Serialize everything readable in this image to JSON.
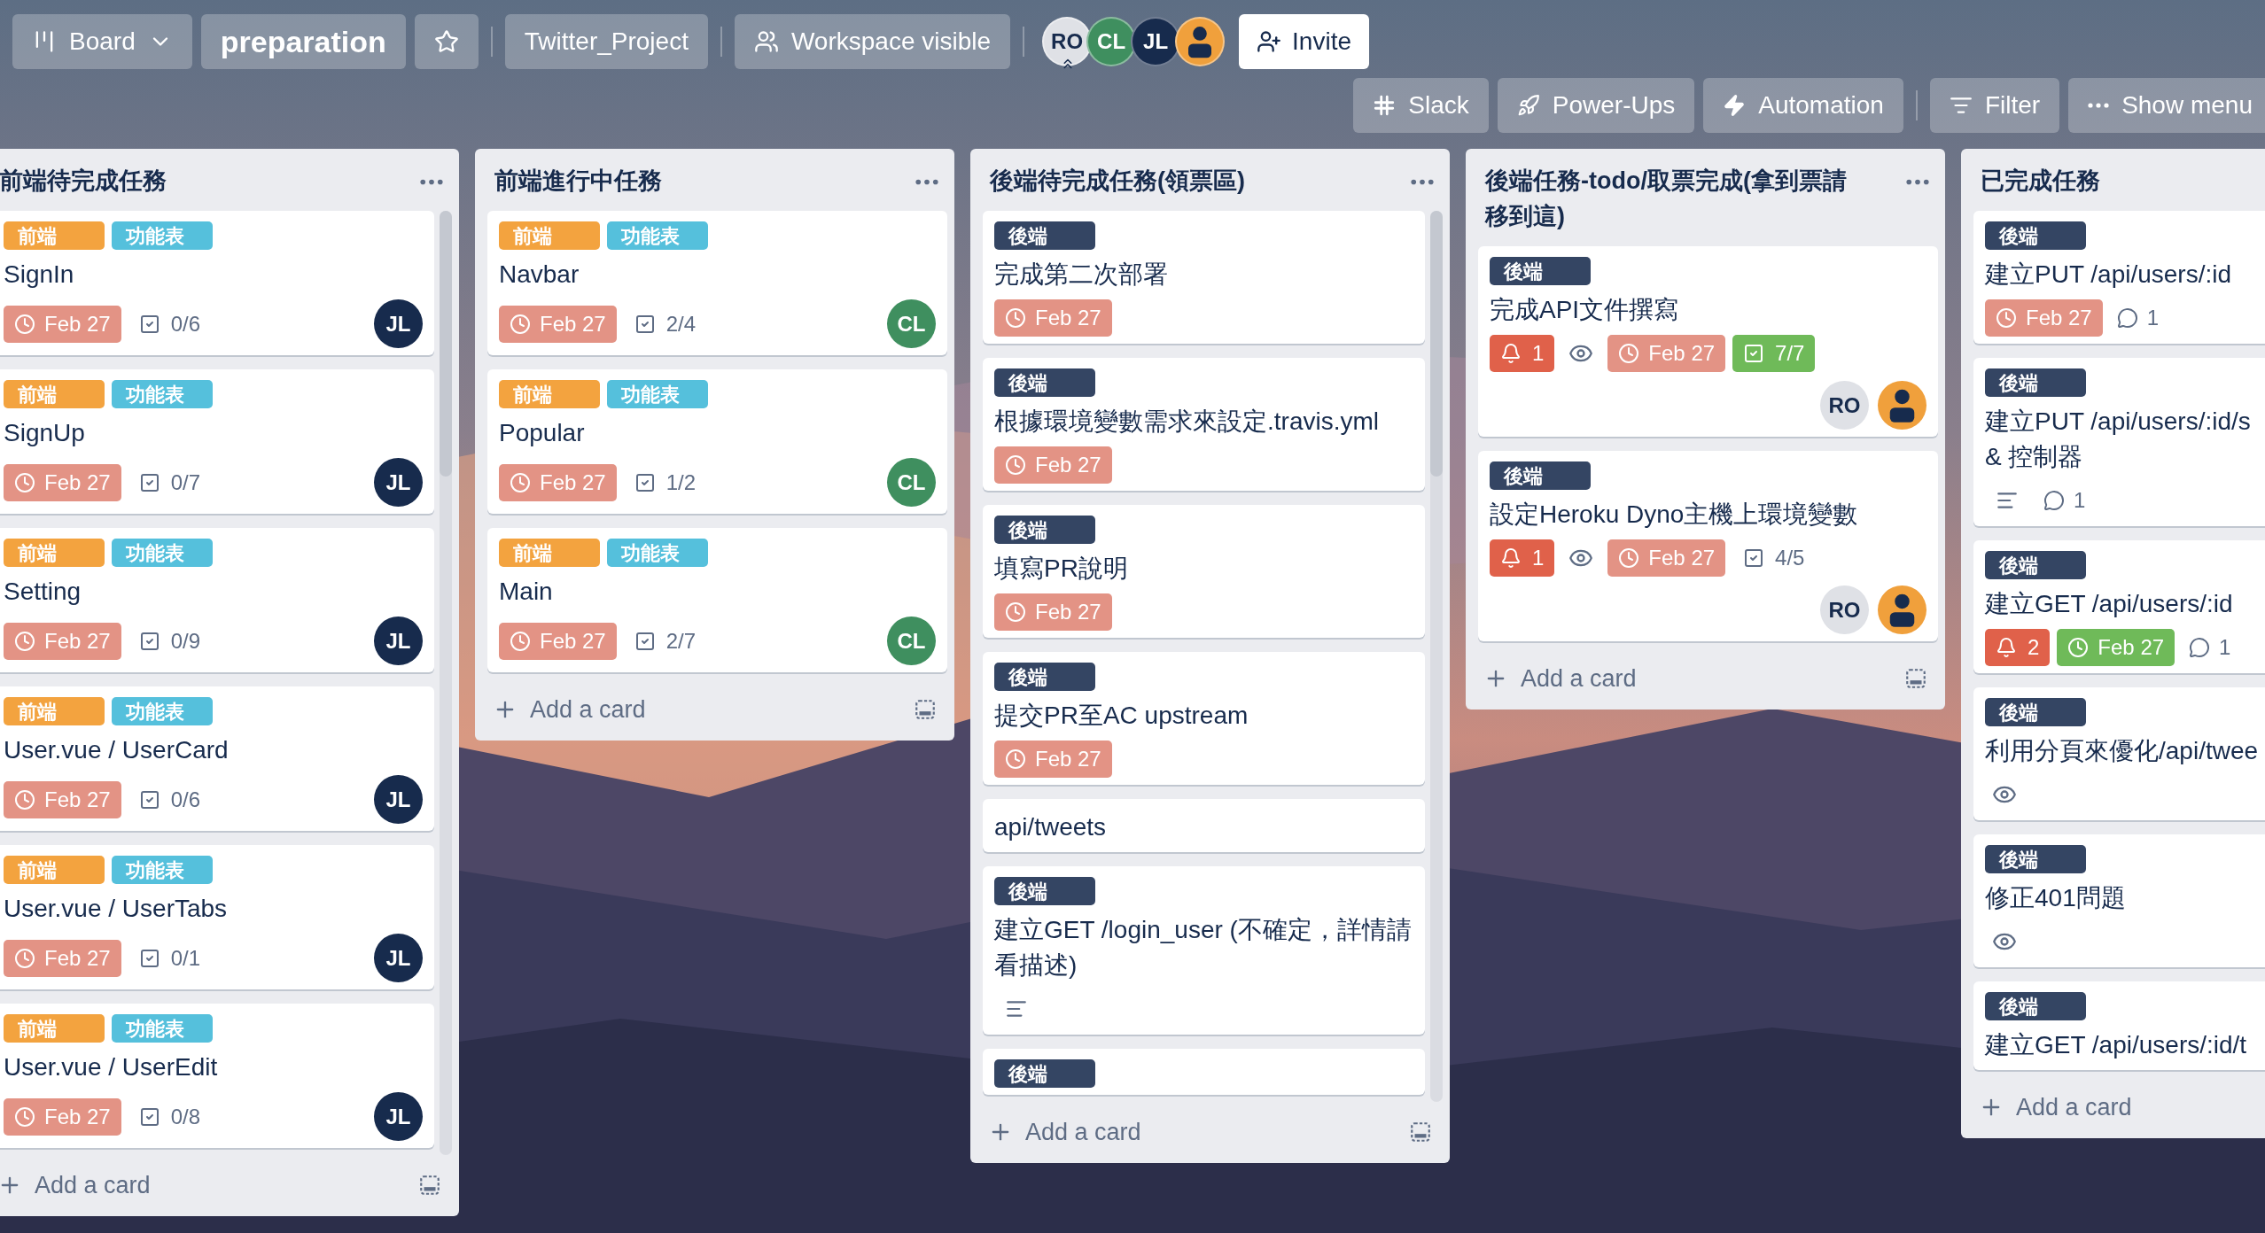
{
  "header": {
    "board_switcher": "Board",
    "board_title": "preparation",
    "starred": false,
    "workspace": "Twitter_Project",
    "visibility": "Workspace visible",
    "members": [
      {
        "kind": "initials",
        "text": "RO",
        "color": "#dfe1e6",
        "admin": true
      },
      {
        "kind": "initials",
        "text": "CL",
        "color": "#3f8f5f",
        "admin": false
      },
      {
        "kind": "initials",
        "text": "JL",
        "color": "#172b4d",
        "admin": false
      },
      {
        "kind": "default",
        "color": "#f0a03c",
        "admin": false
      }
    ],
    "invite": "Invite",
    "toolbar": [
      {
        "kind": "slack",
        "label": "Slack"
      },
      {
        "kind": "power-ups",
        "label": "Power-Ups"
      },
      {
        "kind": "automation",
        "label": "Automation"
      },
      {
        "kind": "filter",
        "label": "Filter"
      },
      {
        "kind": "menu",
        "label": "Show menu"
      }
    ]
  },
  "lists": [
    {
      "title": "前端待完成任務",
      "menu": true,
      "template": true,
      "scrollbar": true,
      "add_card": "Add a card",
      "cards": [
        {
          "labels": [
            {
              "text": "前端",
              "color": "#f3a33f"
            },
            {
              "text": "功能表",
              "color": "#55c0dc"
            }
          ],
          "title": "SignIn",
          "badges": [
            {
              "kind": "due",
              "text": "Feb 27",
              "complete": false
            },
            {
              "kind": "checklist",
              "text": "0/6",
              "complete": false
            }
          ],
          "members": [
            {
              "kind": "initials",
              "text": "JL",
              "color": "#172b4d"
            }
          ]
        },
        {
          "labels": [
            {
              "text": "前端",
              "color": "#f3a33f"
            },
            {
              "text": "功能表",
              "color": "#55c0dc"
            }
          ],
          "title": "SignUp",
          "badges": [
            {
              "kind": "due",
              "text": "Feb 27",
              "complete": false
            },
            {
              "kind": "checklist",
              "text": "0/7",
              "complete": false
            }
          ],
          "members": [
            {
              "kind": "initials",
              "text": "JL",
              "color": "#172b4d"
            }
          ]
        },
        {
          "labels": [
            {
              "text": "前端",
              "color": "#f3a33f"
            },
            {
              "text": "功能表",
              "color": "#55c0dc"
            }
          ],
          "title": "Setting",
          "badges": [
            {
              "kind": "due",
              "text": "Feb 27",
              "complete": false
            },
            {
              "kind": "checklist",
              "text": "0/9",
              "complete": false
            }
          ],
          "members": [
            {
              "kind": "initials",
              "text": "JL",
              "color": "#172b4d"
            }
          ]
        },
        {
          "labels": [
            {
              "text": "前端",
              "color": "#f3a33f"
            },
            {
              "text": "功能表",
              "color": "#55c0dc"
            }
          ],
          "title": "User.vue / UserCard",
          "badges": [
            {
              "kind": "due",
              "text": "Feb 27",
              "complete": false
            },
            {
              "kind": "checklist",
              "text": "0/6",
              "complete": false
            }
          ],
          "members": [
            {
              "kind": "initials",
              "text": "JL",
              "color": "#172b4d"
            }
          ]
        },
        {
          "labels": [
            {
              "text": "前端",
              "color": "#f3a33f"
            },
            {
              "text": "功能表",
              "color": "#55c0dc"
            }
          ],
          "title": "User.vue / UserTabs",
          "badges": [
            {
              "kind": "due",
              "text": "Feb 27",
              "complete": false
            },
            {
              "kind": "checklist",
              "text": "0/1",
              "complete": false
            }
          ],
          "members": [
            {
              "kind": "initials",
              "text": "JL",
              "color": "#172b4d"
            }
          ]
        },
        {
          "labels": [
            {
              "text": "前端",
              "color": "#f3a33f"
            },
            {
              "text": "功能表",
              "color": "#55c0dc"
            }
          ],
          "title": "User.vue / UserEdit",
          "badges": [
            {
              "kind": "due",
              "text": "Feb 27",
              "complete": false
            },
            {
              "kind": "checklist",
              "text": "0/8",
              "complete": false
            }
          ],
          "members": [
            {
              "kind": "initials",
              "text": "JL",
              "color": "#172b4d"
            }
          ]
        }
      ]
    },
    {
      "title": "前端進行中任務",
      "menu": true,
      "template": true,
      "scrollbar": false,
      "add_card": "Add a card",
      "cards": [
        {
          "labels": [
            {
              "text": "前端",
              "color": "#f3a33f"
            },
            {
              "text": "功能表",
              "color": "#55c0dc"
            }
          ],
          "title": "Navbar",
          "badges": [
            {
              "kind": "due",
              "text": "Feb 27",
              "complete": false
            },
            {
              "kind": "checklist",
              "text": "2/4",
              "complete": false
            }
          ],
          "members": [
            {
              "kind": "initials",
              "text": "CL",
              "color": "#3f8f5f"
            }
          ]
        },
        {
          "labels": [
            {
              "text": "前端",
              "color": "#f3a33f"
            },
            {
              "text": "功能表",
              "color": "#55c0dc"
            }
          ],
          "title": "Popular",
          "badges": [
            {
              "kind": "due",
              "text": "Feb 27",
              "complete": false
            },
            {
              "kind": "checklist",
              "text": "1/2",
              "complete": false
            }
          ],
          "members": [
            {
              "kind": "initials",
              "text": "CL",
              "color": "#3f8f5f"
            }
          ]
        },
        {
          "labels": [
            {
              "text": "前端",
              "color": "#f3a33f"
            },
            {
              "text": "功能表",
              "color": "#55c0dc"
            }
          ],
          "title": "Main",
          "badges": [
            {
              "kind": "due",
              "text": "Feb 27",
              "complete": false
            },
            {
              "kind": "checklist",
              "text": "2/7",
              "complete": false
            }
          ],
          "members": [
            {
              "kind": "initials",
              "text": "CL",
              "color": "#3f8f5f"
            }
          ]
        }
      ]
    },
    {
      "title": "後端待完成任務(領票區)",
      "menu": true,
      "template": true,
      "scrollbar": true,
      "add_card": "Add a card",
      "cards": [
        {
          "labels": [
            {
              "text": "後端",
              "color": "#344563"
            }
          ],
          "title": "完成第二次部署",
          "badges": [
            {
              "kind": "due",
              "text": "Feb 27",
              "complete": false
            }
          ]
        },
        {
          "labels": [
            {
              "text": "後端",
              "color": "#344563"
            }
          ],
          "title": "根據環境變數需求來設定.travis.yml",
          "badges": [
            {
              "kind": "due",
              "text": "Feb 27",
              "complete": false
            }
          ]
        },
        {
          "labels": [
            {
              "text": "後端",
              "color": "#344563"
            }
          ],
          "title": "填寫PR說明",
          "badges": [
            {
              "kind": "due",
              "text": "Feb 27",
              "complete": false
            }
          ]
        },
        {
          "labels": [
            {
              "text": "後端",
              "color": "#344563"
            }
          ],
          "title": "提交PR至AC upstream",
          "badges": [
            {
              "kind": "due",
              "text": "Feb 27",
              "complete": false
            }
          ]
        },
        {
          "title": "api/tweets"
        },
        {
          "labels": [
            {
              "text": "後端",
              "color": "#344563"
            }
          ],
          "title": "建立GET /login_user (不確定，詳情請看描述)",
          "badges": [
            {
              "kind": "description"
            }
          ]
        },
        {
          "labels": [
            {
              "text": "後端",
              "color": "#344563"
            }
          ]
        }
      ]
    },
    {
      "title": "後端任務-todo/取票完成(拿到票請移到這)",
      "menu": true,
      "template": true,
      "scrollbar": false,
      "add_card": "Add a card",
      "cards": [
        {
          "labels": [
            {
              "text": "後端",
              "color": "#344563"
            }
          ],
          "title": "完成API文件撰寫",
          "badges": [
            {
              "kind": "notification",
              "text": "1"
            },
            {
              "kind": "watch"
            },
            {
              "kind": "due",
              "text": "Feb 27",
              "complete": false
            },
            {
              "kind": "checklist",
              "text": "7/7",
              "complete": true
            }
          ],
          "members": [
            {
              "kind": "initials",
              "text": "RO",
              "color": "#dfe1e6"
            },
            {
              "kind": "default",
              "color": "#f0a03c"
            }
          ]
        },
        {
          "labels": [
            {
              "text": "後端",
              "color": "#344563"
            }
          ],
          "title": "設定Heroku Dyno主機上環境變數",
          "badges": [
            {
              "kind": "notification",
              "text": "1"
            },
            {
              "kind": "watch"
            },
            {
              "kind": "due",
              "text": "Feb 27",
              "complete": false
            },
            {
              "kind": "checklist",
              "text": "4/5",
              "complete": false
            }
          ],
          "members": [
            {
              "kind": "initials",
              "text": "RO",
              "color": "#dfe1e6"
            },
            {
              "kind": "default",
              "color": "#f0a03c"
            }
          ]
        }
      ]
    },
    {
      "title": "已完成任務",
      "add_card": "Add a card",
      "cards": [
        {
          "labels": [
            {
              "text": "後端",
              "color": "#344563"
            }
          ],
          "title": "建立PUT /api/users/:id",
          "badges": [
            {
              "kind": "due",
              "text": "Feb 27",
              "complete": false
            },
            {
              "kind": "comment",
              "text": "1"
            }
          ]
        },
        {
          "labels": [
            {
              "text": "後端",
              "color": "#344563"
            }
          ],
          "title": "建立PUT /api/users/:id/s\n& 控制器",
          "badges": [
            {
              "kind": "description"
            },
            {
              "kind": "comment",
              "text": "1"
            }
          ]
        },
        {
          "labels": [
            {
              "text": "後端",
              "color": "#344563"
            }
          ],
          "title": "建立GET /api/users/:id",
          "badges": [
            {
              "kind": "notification",
              "text": "2"
            },
            {
              "kind": "due",
              "text": "Feb 27",
              "complete": true
            },
            {
              "kind": "comment",
              "text": "1"
            }
          ]
        },
        {
          "labels": [
            {
              "text": "後端",
              "color": "#344563"
            }
          ],
          "title": "利用分頁來優化/api/twee",
          "badges": [
            {
              "kind": "watch"
            }
          ]
        },
        {
          "labels": [
            {
              "text": "後端",
              "color": "#344563"
            }
          ],
          "title": "修正401問題",
          "badges": [
            {
              "kind": "watch"
            }
          ]
        },
        {
          "labels": [
            {
              "text": "後端",
              "color": "#344563"
            }
          ],
          "title": "建立GET /api/users/:id/t"
        }
      ]
    }
  ]
}
